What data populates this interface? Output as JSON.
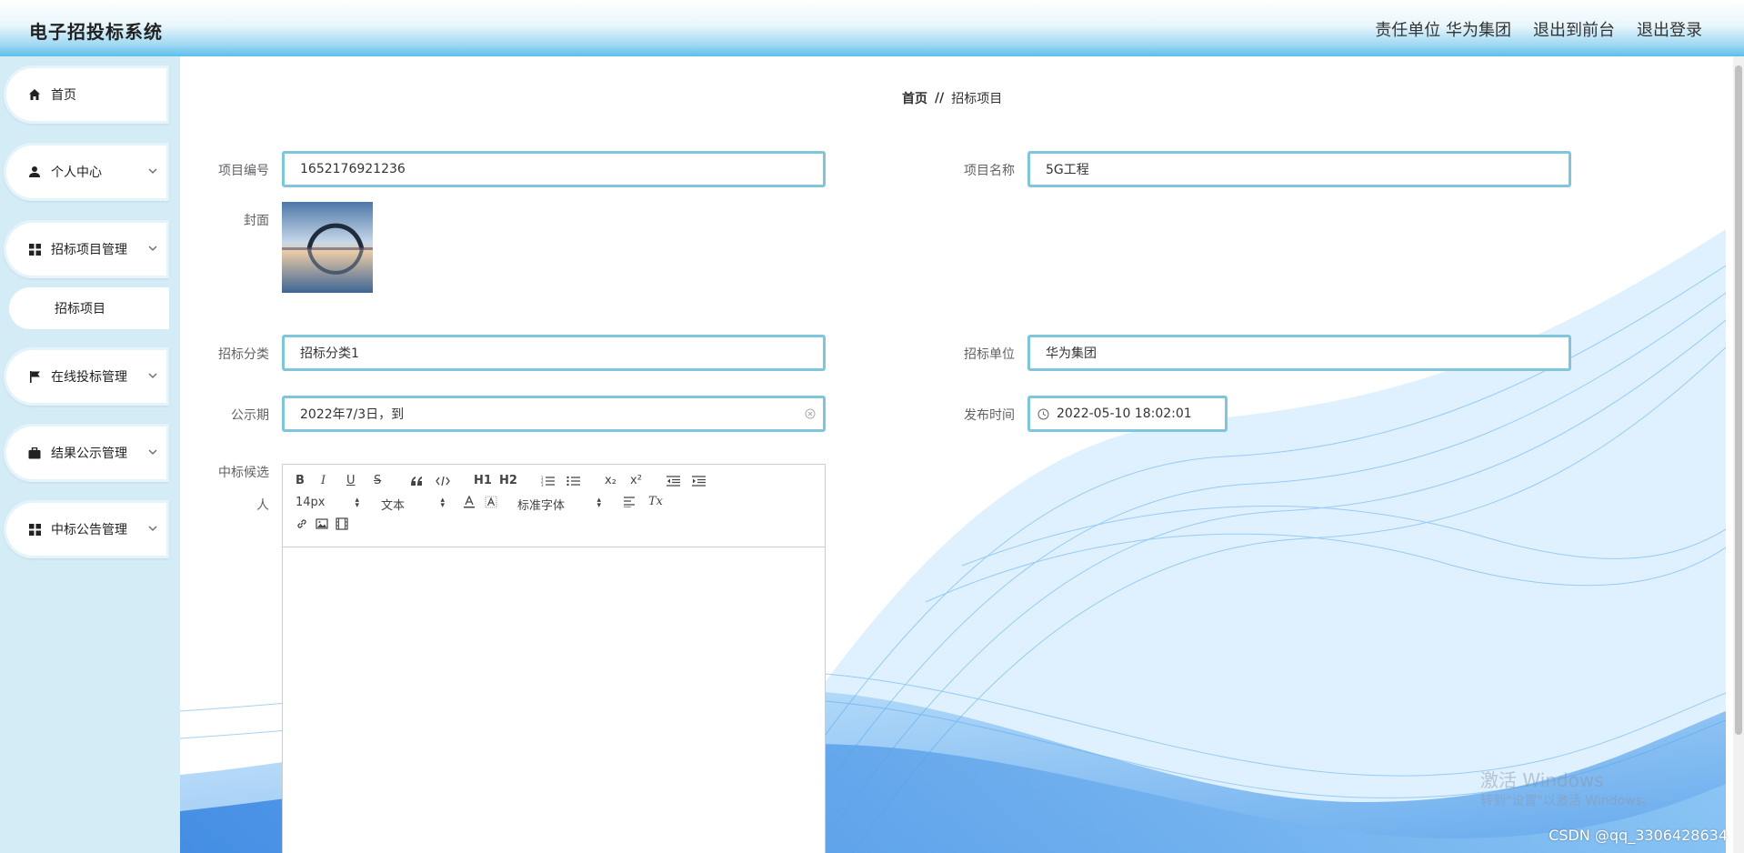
{
  "header": {
    "title": "电子招投标系统",
    "user_info": "责任单位 华为集团",
    "back_to_front": "退出到前台",
    "logout": "退出登录"
  },
  "sidebar": {
    "items": [
      {
        "label": "首页",
        "icon": "home-icon"
      },
      {
        "label": "个人中心",
        "icon": "user-icon"
      },
      {
        "label": "招标项目管理",
        "icon": "grid-icon"
      },
      {
        "label": "在线投标管理",
        "icon": "flag-icon"
      },
      {
        "label": "结果公示管理",
        "icon": "briefcase-icon"
      },
      {
        "label": "中标公告管理",
        "icon": "grid-icon"
      }
    ],
    "subitem": "招标项目"
  },
  "breadcrumb": {
    "home": "首页",
    "separator": "//",
    "current": "招标项目"
  },
  "form": {
    "project_no": {
      "label": "项目编号",
      "value": "1652176921236"
    },
    "project_name": {
      "label": "项目名称",
      "value": "5G工程"
    },
    "cover": {
      "label": "封面"
    },
    "category": {
      "label": "招标分类",
      "value": "招标分类1"
    },
    "unit": {
      "label": "招标单位",
      "value": "华为集团"
    },
    "notice_period": {
      "label": "公示期",
      "value": "2022年7/3日，到"
    },
    "publish_time": {
      "label": "发布时间",
      "value": "2022-05-10 18:02:01"
    },
    "candidate": {
      "label_line1": "中标候选",
      "label_line2": "人"
    }
  },
  "editor": {
    "font_size": "14px",
    "text_type": "文本",
    "font_family": "标准字体",
    "buttons": {
      "bold": "B",
      "italic": "I",
      "underline": "U",
      "strike": "S",
      "h1": "H1",
      "h2": "H2",
      "sub": "x₂",
      "sup": "x²",
      "clear": "Tx"
    }
  },
  "watermark": {
    "line1": "激活 Windows",
    "line2": "转到\"设置\"以激活 Windows。"
  },
  "csdn": "CSDN @qq_3306428634"
}
